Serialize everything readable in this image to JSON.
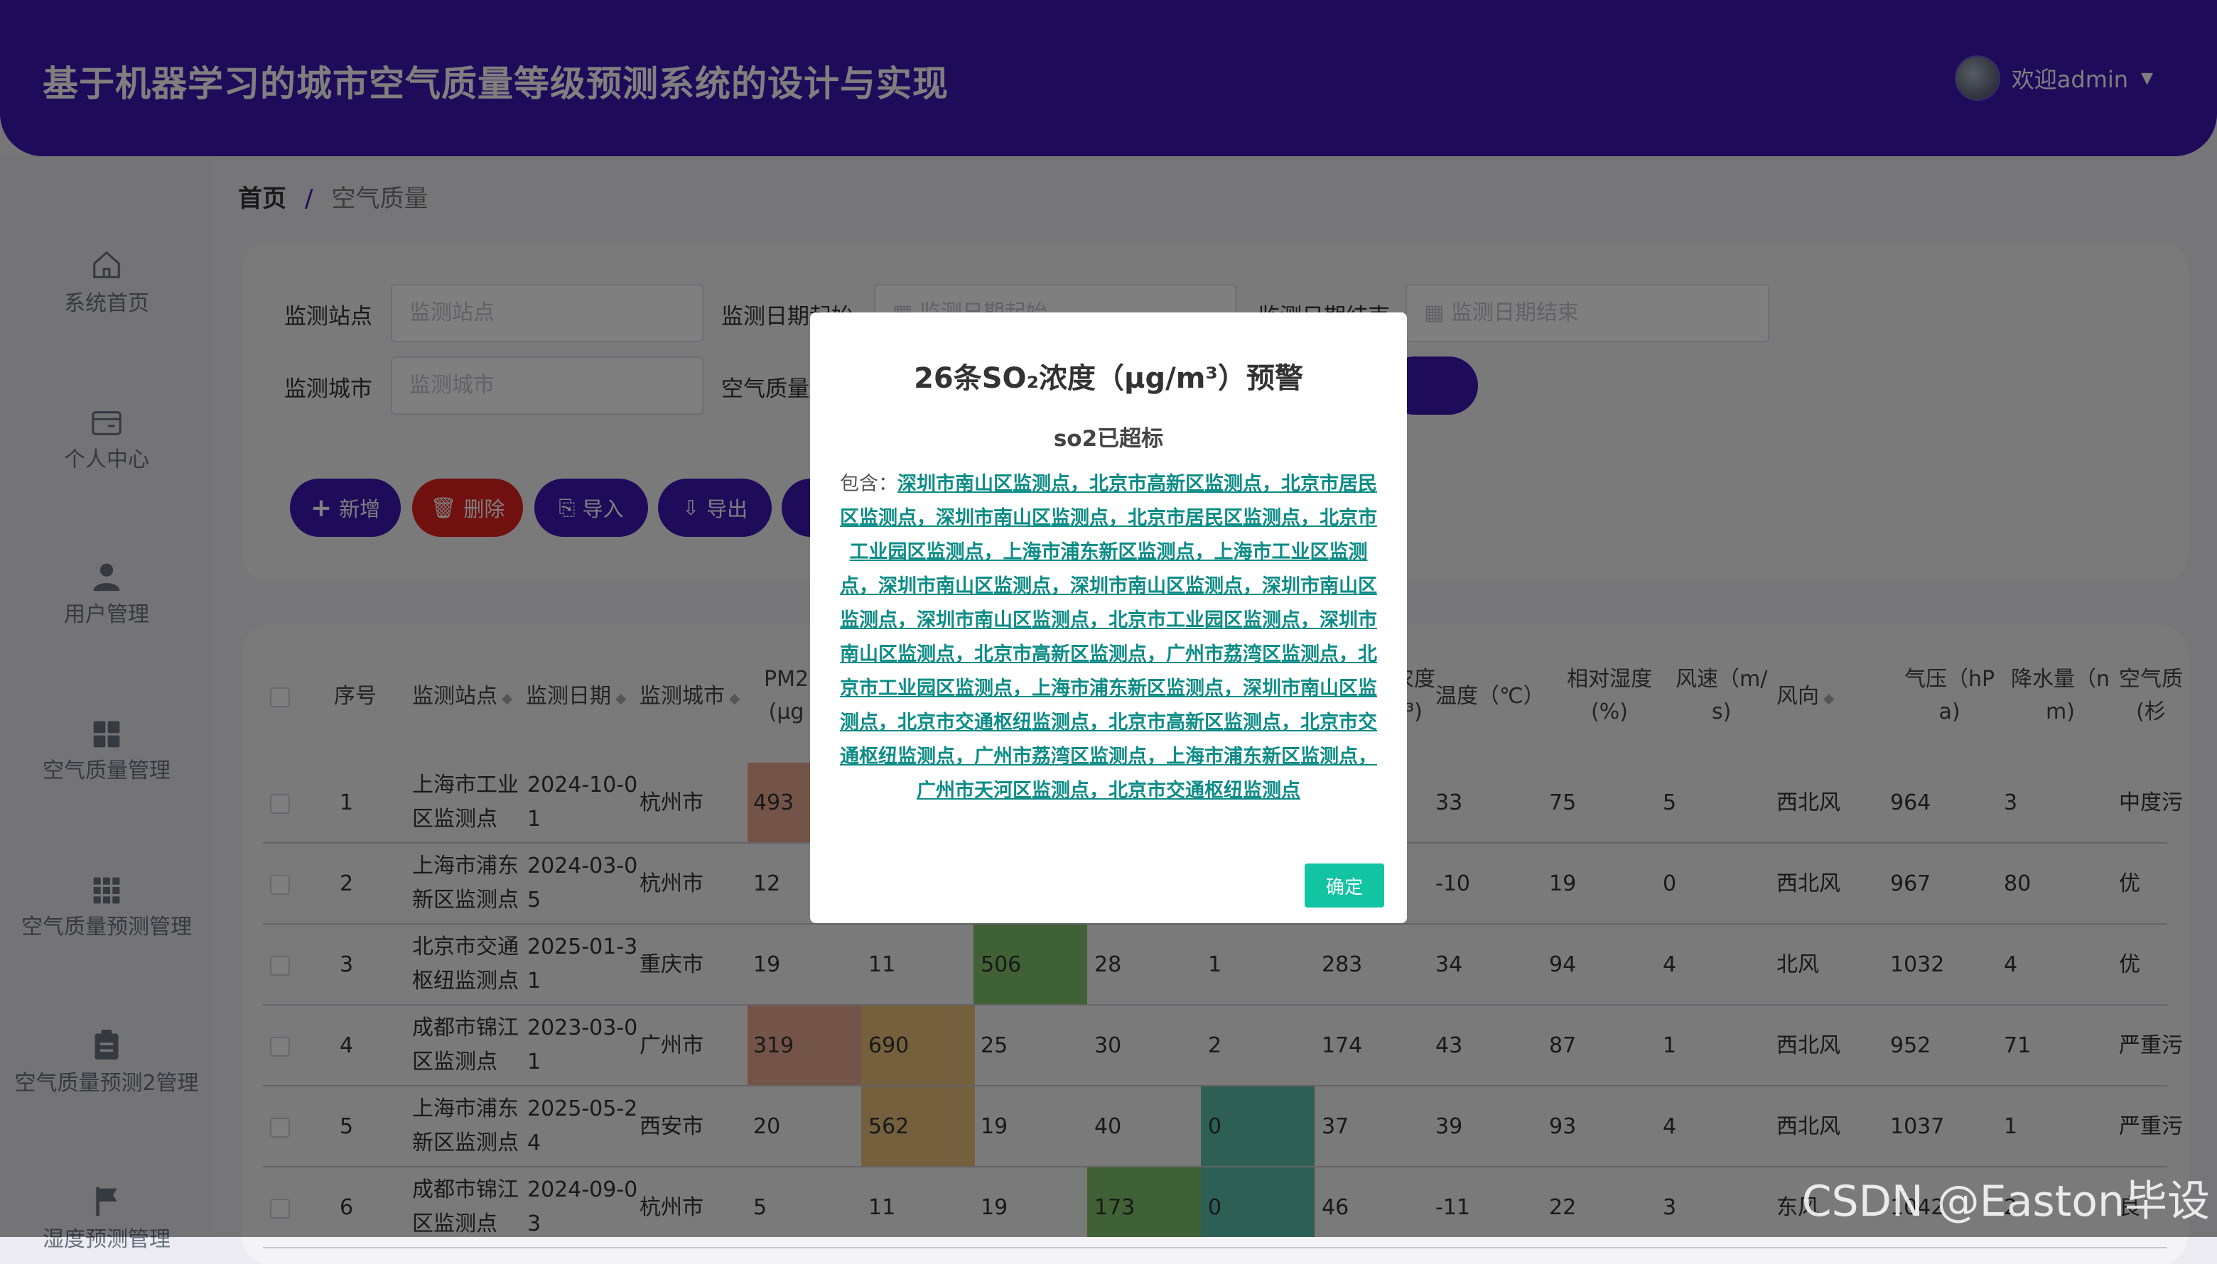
{
  "header": {
    "title": "基于机器学习的城市空气质量等级预测系统的设计与实现",
    "user": "欢迎admin",
    "caret": "▼"
  },
  "sidebar": {
    "items": [
      {
        "label": "系统首页",
        "icon": "home-icon"
      },
      {
        "label": "个人中心",
        "icon": "card-icon"
      },
      {
        "label": "用户管理",
        "icon": "user-icon"
      },
      {
        "label": "空气质量管理",
        "icon": "grid-icon"
      },
      {
        "label": "空气质量预测管理",
        "icon": "apps-icon"
      },
      {
        "label": "空气质量预测2管理",
        "icon": "clipboard-icon"
      },
      {
        "label": "湿度预测管理",
        "icon": "flag-icon"
      }
    ]
  },
  "breadcrumb": {
    "home": "首页",
    "sep": "/",
    "current": "空气质量"
  },
  "search": {
    "station_label": "监测站点",
    "station_placeholder": "监测站点",
    "date_start_label": "监测日期起始",
    "date_start_placeholder": "监测日期起始",
    "date_end_label": "监测日期结束",
    "date_end_placeholder": "监测日期结束",
    "city_label": "监测城市",
    "city_placeholder": "监测城市",
    "quality_label": "空气质量"
  },
  "toolbar": {
    "add": "新增",
    "delete": "删除",
    "import": "导入",
    "export": "导出"
  },
  "table": {
    "headers": {
      "index": "序号",
      "station": "监测站点",
      "date": "监测日期",
      "city": "监测城市",
      "pm25_a": "PM2",
      "pm25_b": "(μg",
      "so2_a": "农度",
      "so2_b": "³)",
      "temp": "温度（℃）",
      "humidity_a": "相对湿度",
      "humidity_b": "(%)",
      "wind_a": "风速（m/",
      "wind_b": "s)",
      "direction": "风向",
      "pressure_a": "气压（hP",
      "pressure_b": "a)",
      "rain_a": "降水量（n",
      "rain_b": "m)",
      "quality_a": "空气质",
      "quality_b": "(杉"
    },
    "rows": [
      {
        "idx": "1",
        "station1": "上海市工业",
        "station2": "区监测点",
        "date1": "2024-10-0",
        "date2": "1",
        "city": "杭州市",
        "pm25": "493",
        "c2": "",
        "c3": "",
        "c4": "",
        "c5": "",
        "c6": "",
        "temp": "33",
        "hum": "75",
        "wind": "5",
        "dir": "西北风",
        "press": "964",
        "rain": "3",
        "quality": "中度污"
      },
      {
        "idx": "2",
        "station1": "上海市浦东",
        "station2": "新区监测点",
        "date1": "2024-03-0",
        "date2": "5",
        "city": "杭州市",
        "pm25": "12",
        "c2": "",
        "c3": "",
        "c4": "",
        "c5": "",
        "c6": "",
        "temp": "-10",
        "hum": "19",
        "wind": "0",
        "dir": "西北风",
        "press": "967",
        "rain": "80",
        "quality": "优"
      },
      {
        "idx": "3",
        "station1": "北京市交通",
        "station2": "枢纽监测点",
        "date1": "2025-01-3",
        "date2": "1",
        "city": "重庆市",
        "pm25": "19",
        "c2": "11",
        "c3": "506",
        "c4": "28",
        "c5": "1",
        "c6": "283",
        "temp": "34",
        "hum": "94",
        "wind": "4",
        "dir": "北风",
        "press": "1032",
        "rain": "4",
        "quality": "优"
      },
      {
        "idx": "4",
        "station1": "成都市锦江",
        "station2": "区监测点",
        "date1": "2023-03-0",
        "date2": "1",
        "city": "广州市",
        "pm25": "319",
        "c2": "690",
        "c3": "25",
        "c4": "30",
        "c5": "2",
        "c6": "174",
        "temp": "43",
        "hum": "87",
        "wind": "1",
        "dir": "西北风",
        "press": "952",
        "rain": "71",
        "quality": "严重污"
      },
      {
        "idx": "5",
        "station1": "上海市浦东",
        "station2": "新区监测点",
        "date1": "2025-05-2",
        "date2": "4",
        "city": "西安市",
        "pm25": "20",
        "c2": "562",
        "c3": "19",
        "c4": "40",
        "c5": "0",
        "c6": "37",
        "temp": "39",
        "hum": "93",
        "wind": "4",
        "dir": "西北风",
        "press": "1037",
        "rain": "1",
        "quality": "严重污"
      },
      {
        "idx": "6",
        "station1": "成都市锦江",
        "station2": "区监测点",
        "date1": "2024-09-0",
        "date2": "3",
        "city": "杭州市",
        "pm25": "5",
        "c2": "11",
        "c3": "19",
        "c4": "173",
        "c5": "0",
        "c6": "46",
        "temp": "-11",
        "hum": "22",
        "wind": "3",
        "dir": "东风",
        "press": "1042",
        "rain": "2",
        "quality": "良"
      }
    ]
  },
  "dialog": {
    "title": "26条SO₂浓度（μg/m³）预警",
    "subtitle": "so2已超标",
    "prefix": "包含：",
    "stations": "深圳市南山区监测点，北京市高新区监测点，北京市居民区监测点，深圳市南山区监测点，北京市居民区监测点，北京市工业园区监测点，上海市浦东新区监测点，上海市工业区监测点，深圳市南山区监测点，深圳市南山区监测点，深圳市南山区监测点，深圳市南山区监测点，北京市工业园区监测点，深圳市南山区监测点，北京市高新区监测点，广州市荔湾区监测点，北京市工业园区监测点，上海市浦东新区监测点，深圳市南山区监测点，北京市交通枢纽监测点，北京市高新区监测点，北京市交通枢纽监测点，广州市荔湾区监测点，上海市浦东新区监测点，广州市天河区监测点，北京市交通枢纽监测点",
    "ok": "确定"
  },
  "watermark": "CSDN @Easton毕设",
  "colors": {
    "header": "#3c17b5",
    "add": "#3c17b5",
    "delete": "#e0201f",
    "ok": "#13c4a3",
    "link": "#0d8c86",
    "cell_red": "#e9a890",
    "cell_orange": "#e8c07a",
    "cell_green": "#7fc26a",
    "cell_teal": "#5cbfa8"
  }
}
